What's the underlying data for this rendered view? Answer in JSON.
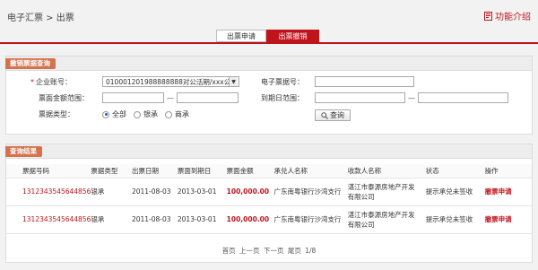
{
  "header": {
    "breadcrumb": "电子汇票 > 出票",
    "func_intro": "功能介绍"
  },
  "tabs": [
    {
      "label": "出票申请",
      "active": false
    },
    {
      "label": "出票撤销",
      "active": true
    }
  ],
  "search": {
    "title": "撤销票据查询",
    "account_label": "企业账号：",
    "account_value": "010001201988888888对公活期/xxx公",
    "bill_no_label": "电子票据号：",
    "amount_label": "票面金额范围：",
    "due_label": "到期日范围：",
    "type_label": "票据类型：",
    "type_options": [
      "全部",
      "银承",
      "商承"
    ],
    "type_selected": "全部",
    "query_button": "查询"
  },
  "result": {
    "title": "查询结果",
    "columns": [
      "票据号码",
      "票据类型",
      "出票日期",
      "票面到期日",
      "票面金额",
      "承兑人名称",
      "收款人名称",
      "状态",
      "操作"
    ],
    "rows": [
      {
        "bill_no": "1312343545644856",
        "type": "银承",
        "issue_date": "2011-08-03",
        "due_date": "2013-03-01",
        "amount": "100,000.00",
        "acceptor": "广东南粤银行沙湾支行",
        "payee_line1": "湛江市泰源房地产开发",
        "payee_line2": "有限公司",
        "status": "提示承兑未签收",
        "action": "撤票申请"
      },
      {
        "bill_no": "1312343545644856",
        "type": "银承",
        "issue_date": "2011-08-03",
        "due_date": "2013-03-01",
        "amount": "100,000.00",
        "acceptor": "广东南粤银行沙湾支行",
        "payee_line1": "湛江市泰源房地产开发",
        "payee_line2": "有限公司",
        "status": "提示承兑未签收",
        "action": "撤票申请"
      }
    ],
    "pager": {
      "first": "首页",
      "prev": "上一页",
      "next": "下一页",
      "last": "尾页",
      "page": "1/8"
    }
  },
  "colors": {
    "accent": "#c0141c",
    "tag": "#d3724e"
  }
}
